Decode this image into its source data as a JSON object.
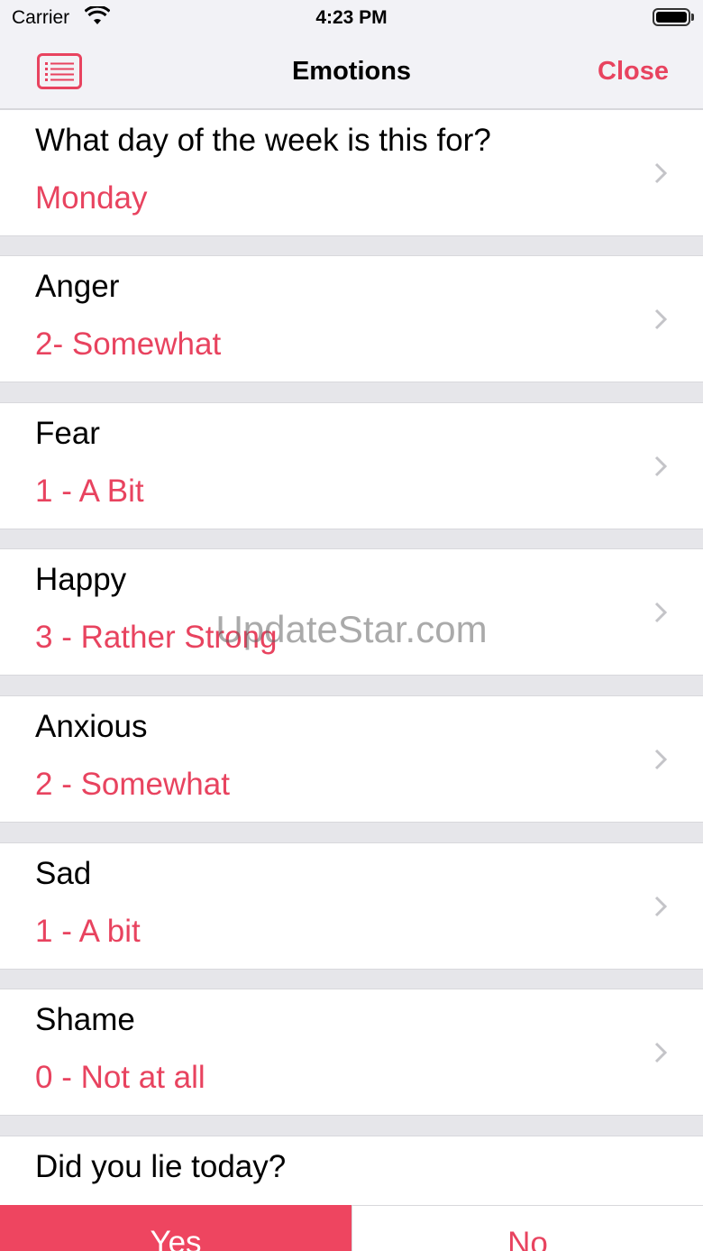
{
  "status_bar": {
    "carrier": "Carrier",
    "time": "4:23 PM"
  },
  "nav": {
    "title": "Emotions",
    "close_label": "Close",
    "left_icon": "list-icon"
  },
  "rows": [
    {
      "title": "What day of the week is this for?",
      "value": "Monday"
    },
    {
      "title": "Anger",
      "value": "2- Somewhat"
    },
    {
      "title": "Fear",
      "value": "1 - A Bit"
    },
    {
      "title": "Happy",
      "value": "3 - Rather Strong"
    },
    {
      "title": "Anxious",
      "value": "2 - Somewhat"
    },
    {
      "title": "Sad",
      "value": "1 - A bit"
    },
    {
      "title": "Shame",
      "value": "0 - Not at all"
    }
  ],
  "lie_question": {
    "title": "Did you lie today?",
    "yes_label": "Yes",
    "no_label": "No"
  },
  "watermark": "UpdateStar.com",
  "colors": {
    "accent": "#e8435f",
    "selected_fill": "#ee4560",
    "separator_bg": "#e6e6ea"
  }
}
